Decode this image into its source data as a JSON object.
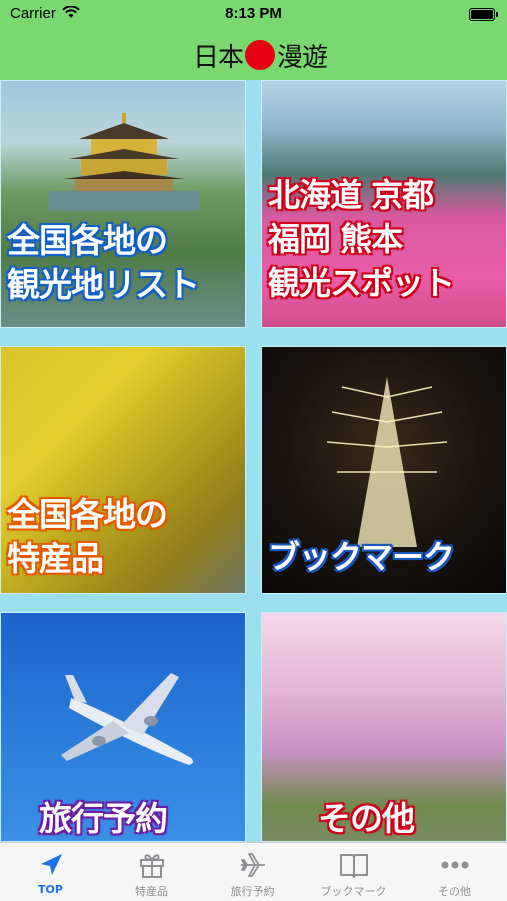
{
  "status_bar": {
    "carrier": "Carrier",
    "time": "8:13 PM"
  },
  "header": {
    "logo_left": "日本",
    "logo_right": "漫遊"
  },
  "tiles": [
    {
      "lines": [
        "全国各地の",
        "観光地リスト"
      ]
    },
    {
      "lines": [
        "北海道 京都",
        "福岡 熊本",
        "観光スポット"
      ]
    },
    {
      "lines": [
        "全国各地の",
        "特産品"
      ]
    },
    {
      "lines": [
        "ブックマーク"
      ]
    },
    {
      "lines": [
        "旅行予約"
      ]
    },
    {
      "lines": [
        "その他"
      ]
    }
  ],
  "tabbar": {
    "items": [
      {
        "label": "TOP",
        "icon": "navigation-arrow-icon",
        "active": true
      },
      {
        "label": "特産品",
        "icon": "gift-icon",
        "active": false
      },
      {
        "label": "旅行予約",
        "icon": "airplane-icon",
        "active": false
      },
      {
        "label": "ブックマーク",
        "icon": "book-icon",
        "active": false
      },
      {
        "label": "その他",
        "icon": "more-dots-icon",
        "active": false
      }
    ]
  },
  "colors": {
    "header_bg": "#7ad870",
    "grid_bg": "#9be0ef",
    "logo_sun": "#e60012",
    "tab_active": "#1a73e8",
    "tab_inactive": "#8e8e93"
  }
}
